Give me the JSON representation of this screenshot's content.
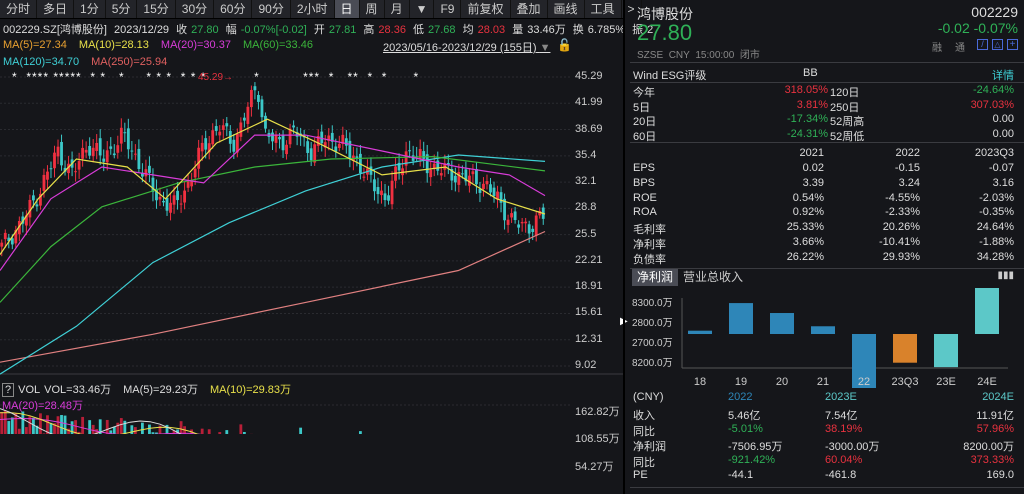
{
  "toolbar": [
    "分时",
    "多日",
    "1分",
    "5分",
    "15分",
    "30分",
    "60分",
    "90分",
    "2小时",
    "日",
    "周",
    "月",
    "▼",
    "F9",
    "前复权",
    "叠加",
    "画线",
    "工具",
    ">"
  ],
  "toolbar_active": "日",
  "info": {
    "code": "002229.SZ[鸿博股份]",
    "date": "2023/12/29",
    "close_label": "收",
    "close": "27.80",
    "chg_label": "幅",
    "chg": "-0.07%[-0.02]",
    "open_label": "开",
    "open": "27.81",
    "high_label": "高",
    "high": "28.36",
    "low_label": "低",
    "low": "27.68",
    "avg_label": "均",
    "avg": "28.03",
    "vol_label": "量",
    "vol": "33.46万",
    "turn_label": "换",
    "turn": "6.785%",
    "amp_label": "振",
    "amp": "2"
  },
  "ma": {
    "ma5": "MA(5)=27.34",
    "ma10": "MA(10)=28.13",
    "ma20": "MA(20)=30.37",
    "ma60": "MA(60)=33.46",
    "ma120": "MA(120)=34.70",
    "ma250": "MA(250)=25.94"
  },
  "range": "2023/05/16-2023/12/29 (155日)",
  "stars": "*  **** *****  * *   *     * * *  * * *           *          ***  *   **  *  *      *",
  "peak_label": "45.29",
  "price_axis": [
    "45.29",
    "41.99",
    "38.69",
    "35.4",
    "32.1",
    "28.8",
    "25.5",
    "22.21",
    "18.91",
    "15.61",
    "12.31",
    "9.02"
  ],
  "price_range": [
    9.02,
    45.29
  ],
  "price_path": [
    [
      0,
      24
    ],
    [
      8,
      27
    ],
    [
      15,
      31
    ],
    [
      22,
      36
    ],
    [
      28,
      33
    ],
    [
      34,
      37
    ],
    [
      40,
      35
    ],
    [
      48,
      38
    ],
    [
      55,
      34
    ],
    [
      62,
      30
    ],
    [
      68,
      29
    ],
    [
      74,
      32
    ],
    [
      80,
      37
    ],
    [
      86,
      39
    ],
    [
      92,
      37
    ],
    [
      98,
      42
    ],
    [
      101,
      44.5
    ],
    [
      104,
      38
    ],
    [
      110,
      37
    ],
    [
      116,
      38.5
    ],
    [
      122,
      36
    ],
    [
      128,
      37.5
    ],
    [
      134,
      37
    ],
    [
      140,
      35
    ],
    [
      146,
      32
    ],
    [
      152,
      30
    ],
    [
      160,
      36
    ],
    [
      170,
      34
    ],
    [
      180,
      33
    ],
    [
      190,
      32
    ],
    [
      196,
      30
    ],
    [
      202,
      27
    ],
    [
      208,
      26.5
    ],
    [
      214,
      27.8
    ]
  ],
  "ma_lines": {
    "ma250": [
      [
        0,
        9.5
      ],
      [
        60,
        13
      ],
      [
        120,
        17
      ],
      [
        180,
        21
      ],
      [
        214,
        25.9
      ]
    ],
    "ma120": [
      [
        0,
        8
      ],
      [
        30,
        14
      ],
      [
        60,
        22
      ],
      [
        90,
        27
      ],
      [
        120,
        31
      ],
      [
        150,
        34
      ],
      [
        180,
        35.5
      ],
      [
        214,
        34.7
      ]
    ],
    "ma60": [
      [
        0,
        17
      ],
      [
        20,
        24
      ],
      [
        40,
        29
      ],
      [
        70,
        32
      ],
      [
        100,
        34
      ],
      [
        130,
        35
      ],
      [
        170,
        35.3
      ],
      [
        214,
        33.5
      ]
    ],
    "ma20": [
      [
        0,
        21
      ],
      [
        20,
        30
      ],
      [
        40,
        34
      ],
      [
        60,
        33
      ],
      [
        80,
        32
      ],
      [
        100,
        38
      ],
      [
        120,
        38
      ],
      [
        150,
        36
      ],
      [
        180,
        34
      ],
      [
        200,
        33
      ],
      [
        214,
        30.4
      ]
    ],
    "ma10": [
      [
        0,
        23
      ],
      [
        15,
        30
      ],
      [
        30,
        35
      ],
      [
        50,
        34
      ],
      [
        65,
        30
      ],
      [
        85,
        37
      ],
      [
        105,
        40
      ],
      [
        125,
        37
      ],
      [
        150,
        33
      ],
      [
        175,
        34
      ],
      [
        195,
        30
      ],
      [
        214,
        28.1
      ]
    ]
  },
  "vol": {
    "title": "VOL",
    "vol": "VOL=33.46万",
    "ma5": "MA(5)=29.23万",
    "ma10": "MA(10)=29.83万",
    "ma20": "MA(20)=28.48万",
    "axis": [
      "162.82万",
      "108.55万",
      "54.27万"
    ]
  },
  "quote": {
    "name": "鸿博股份",
    "code": "002229",
    "price": "27.80",
    "chg": "-0.02",
    "pct": "-0.07%",
    "exchange": "SZSE",
    "currency": "CNY",
    "time": "15:00:00",
    "status": "闭市",
    "rong": "融",
    "tong": "通"
  },
  "esg": {
    "label": "Wind ESG评级",
    "value": "BB",
    "detail": "详情"
  },
  "perf": [
    [
      "今年",
      "318.05%",
      "120日",
      "-24.64%"
    ],
    [
      "5日",
      "3.81%",
      "250日",
      "307.03%"
    ],
    [
      "20日",
      "-17.34%",
      "52周高",
      "0.00"
    ],
    [
      "60日",
      "-24.31%",
      "52周低",
      "0.00"
    ]
  ],
  "fin": {
    "headers": [
      "2021",
      "2022",
      "2023Q3"
    ],
    "rows": [
      [
        "EPS",
        "0.02",
        "-0.15",
        "-0.07"
      ],
      [
        "BPS",
        "3.39",
        "3.24",
        "3.16"
      ],
      [
        "ROE",
        "0.54%",
        "-4.55%",
        "-2.03%"
      ],
      [
        "ROA",
        "0.92%",
        "-2.33%",
        "-0.35%"
      ],
      [
        "毛利率",
        "25.33%",
        "20.26%",
        "24.64%"
      ],
      [
        "净利率",
        "3.66%",
        "-10.41%",
        "-1.88%"
      ],
      [
        "负债率",
        "26.22%",
        "29.93%",
        "34.28%"
      ]
    ]
  },
  "tabs": [
    "净利润",
    "营业总收入"
  ],
  "bar_chart": {
    "yaxis": [
      "8300.0万",
      "2800.0万",
      "2700.0万",
      "8200.0万"
    ],
    "categories": [
      "18",
      "19",
      "20",
      "21",
      "22",
      "23Q3",
      "23E",
      "24E"
    ],
    "values": [
      300,
      2800,
      1900,
      700,
      -7507,
      -2600,
      -3000,
      8200
    ],
    "colors": [
      "#2e86b8",
      "#2e86b8",
      "#2e86b8",
      "#2e86b8",
      "#2e86b8",
      "#d9822b",
      "#5cc8c8",
      "#5cc8c8"
    ]
  },
  "forecast": {
    "headers": [
      "(CNY)",
      "2022",
      "2023E",
      "2024E"
    ],
    "rows": [
      [
        "收入",
        "5.46亿",
        "7.54亿",
        "11.91亿"
      ],
      [
        "同比",
        "-5.01%",
        "38.19%",
        "57.96%"
      ],
      [
        "净利润",
        "-7506.95万",
        "-3000.00万",
        "8200.00万"
      ],
      [
        "同比",
        "-921.42%",
        "60.04%",
        "373.33%"
      ],
      [
        "PE",
        "-44.1",
        "-461.8",
        "169.0"
      ]
    ]
  }
}
